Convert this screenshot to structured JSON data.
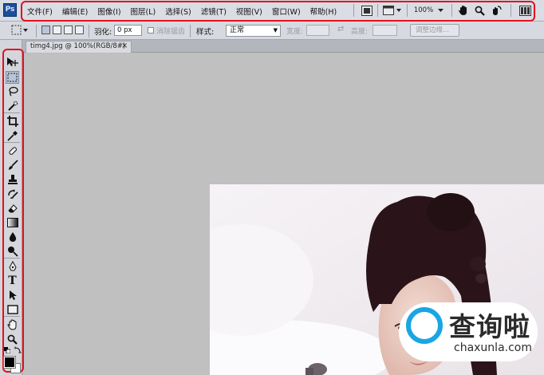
{
  "app": {
    "logo_text": "Ps"
  },
  "menu": {
    "items": [
      "文件(F)",
      "编辑(E)",
      "图像(I)",
      "图层(L)",
      "选择(S)",
      "滤镜(T)",
      "视图(V)",
      "窗口(W)",
      "帮助(H)"
    ],
    "zoom": "100%"
  },
  "options": {
    "feather_label": "羽化:",
    "feather_value": "0 px",
    "antialias_label": "消除锯齿",
    "style_label": "样式:",
    "style_value": "正常",
    "width_label": "宽度:",
    "height_label": "高度:",
    "refine_edge_label": "调整边缘..."
  },
  "document": {
    "tab_title": "timg4.jpg @ 100%(RGB/8#)",
    "close_glyph": "×"
  },
  "tools": {
    "type_glyph": "T"
  },
  "watermark": {
    "text": "查询啦",
    "url": "chaxunla.com",
    "accent_color": "#1aa5e3"
  },
  "colors": {
    "highlight": "#e4101e",
    "foreground": "#000000",
    "background": "#ffffff"
  }
}
